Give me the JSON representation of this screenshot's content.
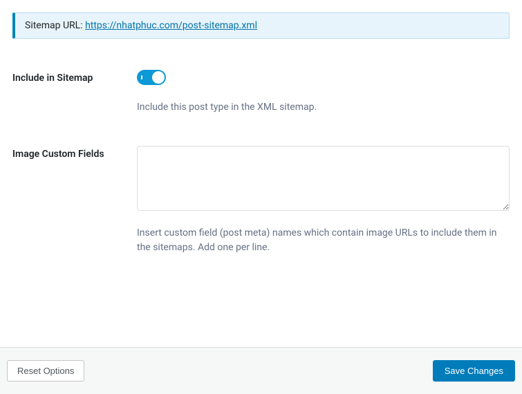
{
  "notice": {
    "label": "Sitemap URL: ",
    "url_text": "https://nhatphuc.com/post-sitemap.xml"
  },
  "fields": {
    "include_sitemap": {
      "label": "Include in Sitemap",
      "description": "Include this post type in the XML sitemap.",
      "enabled": true
    },
    "image_custom_fields": {
      "label": "Image Custom Fields",
      "value": "",
      "description": "Insert custom field (post meta) names which contain image URLs to include them in the sitemaps. Add one per line."
    }
  },
  "footer": {
    "reset_label": "Reset Options",
    "save_label": "Save Changes"
  }
}
